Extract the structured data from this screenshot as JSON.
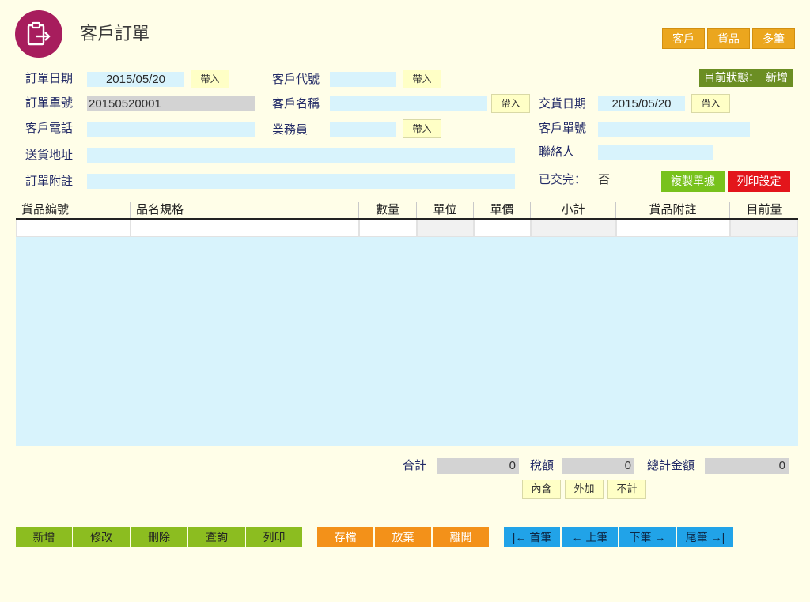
{
  "app": {
    "title": "客戶訂單",
    "logo_icon": "clipboard-export-icon"
  },
  "colors": {
    "background": "#fffee8",
    "logo": "#a71d5d",
    "input": "#d8f3fc",
    "readonly_input": "#d3d3d3",
    "nav_button": "#eba61e",
    "status": "#6b8e23",
    "copy_button": "#78c21c",
    "print_settings_button": "#e3151b",
    "record_button": "#8cbd20",
    "save_button": "#f39119",
    "navigation_button": "#21a3e8"
  },
  "top_nav": {
    "customer": "客戶",
    "goods": "貨品",
    "multi": "多筆"
  },
  "status": {
    "label": "目前狀態：",
    "value": "新增"
  },
  "form": {
    "order_date": {
      "label": "訂單日期",
      "value": "2015/05/20",
      "import_label": "帶入"
    },
    "order_no": {
      "label": "訂單單號",
      "value": "20150520001"
    },
    "customer_phone": {
      "label": "客戶電話",
      "value": ""
    },
    "shipping_address": {
      "label": "送貨地址",
      "value": ""
    },
    "order_note": {
      "label": "訂單附註",
      "value": ""
    },
    "customer_code": {
      "label": "客戶代號",
      "value": "",
      "import_label": "帶入"
    },
    "customer_name": {
      "label": "客戶名稱",
      "value": "",
      "import_label": "帶入"
    },
    "salesperson": {
      "label": "業務員",
      "value": "",
      "import_label": "帶入"
    },
    "delivery_date": {
      "label": "交貨日期",
      "value": "2015/05/20",
      "import_label": "帶入"
    },
    "customer_order_no": {
      "label": "客戶單號",
      "value": ""
    },
    "contact": {
      "label": "聯絡人",
      "value": ""
    },
    "delivered": {
      "label": "已交完：",
      "value": "否"
    }
  },
  "actions": {
    "copy": "複製單據",
    "print_settings": "列印設定"
  },
  "table": {
    "columns": [
      "貨品編號",
      "品名規格",
      "數量",
      "單位",
      "單價",
      "小計",
      "貨品附註",
      "目前量"
    ]
  },
  "totals": {
    "subtotal": {
      "label": "合計",
      "value": "0"
    },
    "tax": {
      "label": "稅額",
      "value": "0"
    },
    "grand_total": {
      "label": "總計金額",
      "value": "0"
    }
  },
  "tax_modes": {
    "inclusive": "內含",
    "exclusive": "外加",
    "none": "不計"
  },
  "toolbar": {
    "new": "新增",
    "edit": "修改",
    "delete": "刪除",
    "search": "查詢",
    "print": "列印",
    "save": "存檔",
    "discard": "放棄",
    "exit": "離開",
    "first": "|← 首筆",
    "prev": "← 上筆",
    "next": "下筆 →",
    "last": "尾筆 →|"
  }
}
